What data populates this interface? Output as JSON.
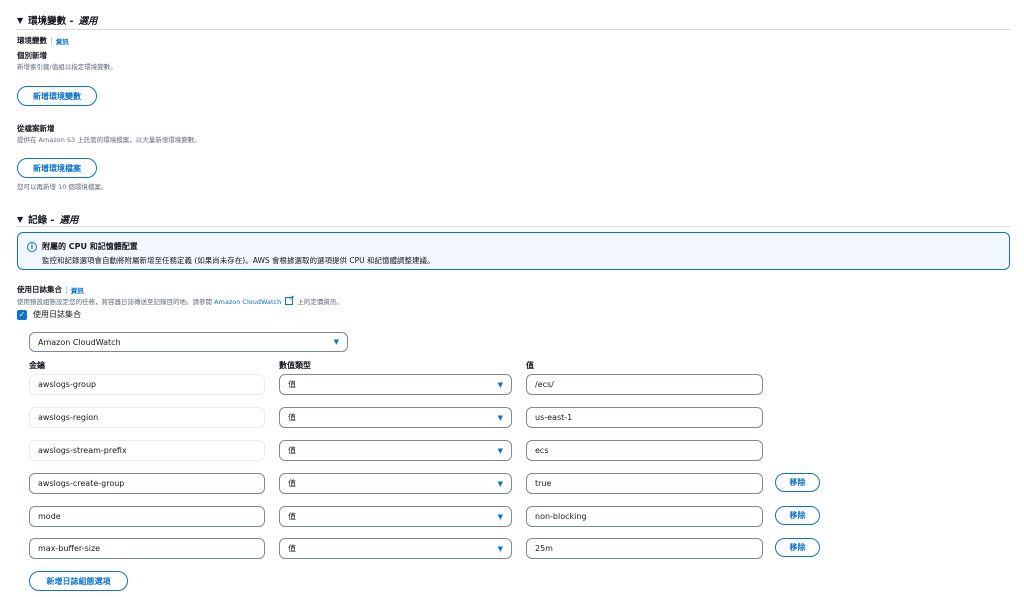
{
  "env_section": {
    "title": "環境變數 -",
    "optional": "選用",
    "label": "環境變數",
    "info_link": "資訊",
    "individual": {
      "label": "個別新增",
      "desc": "新增索引鍵/值組以指定環境變數。",
      "button": "新增環境變數"
    },
    "from_file": {
      "label": "從檔案新增",
      "desc": "提供在 Amazon S3 上託管的環境檔案，以大量新增環境變數。",
      "button": "新增環境檔案",
      "note": "您可以再新增 10 個環境檔案。"
    }
  },
  "logging_section": {
    "title": "記錄 -",
    "optional": "選用",
    "alert": {
      "title": "附屬的 CPU 和記憶體配置",
      "body": "監控和記錄選項會自動將附屬新增至任務定義 (如果尚未存在)。AWS 會根據選取的選項提供 CPU 和記憶體調整建議。"
    },
    "use_log_collection": {
      "label": "使用日誌集合",
      "info_link": "資訊",
      "desc_before": "使用預設組態設定您的任務，將容器日誌傳送至記錄目的地。請參閱",
      "desc_link": "Amazon CloudWatch",
      "desc_after": "上的定價資訊。",
      "checkbox_label": "使用日誌集合",
      "checked": true
    },
    "destination": "Amazon CloudWatch",
    "columns": {
      "key": "金鑰",
      "value_type": "數值類型",
      "value": "值"
    },
    "rows": [
      {
        "key": "awslogs-group",
        "type": "值",
        "value": "/ecs/",
        "remove": ""
      },
      {
        "key": "awslogs-region",
        "type": "值",
        "value": "us-east-1",
        "remove": ""
      },
      {
        "key": "awslogs-stream-prefix",
        "type": "值",
        "value": "ecs",
        "remove": ""
      },
      {
        "key": "awslogs-create-group",
        "type": "值",
        "value": "true",
        "remove": "移除"
      },
      {
        "key": "mode",
        "type": "值",
        "value": "non-blocking",
        "remove": "移除"
      },
      {
        "key": "max-buffer-size",
        "type": "值",
        "value": "25m",
        "remove": "移除"
      }
    ],
    "add_option_button": "新增日誌組態選項"
  },
  "colors": {
    "accent": "#0972d3",
    "alert_bg": "#f2f8fd"
  }
}
